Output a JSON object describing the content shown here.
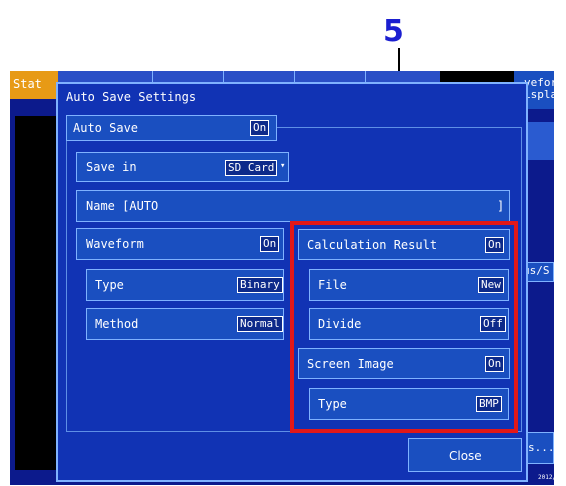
{
  "callout": {
    "number": "5"
  },
  "background": {
    "tab_left": "Stat",
    "right_header": [
      "vefor",
      "isplay"
    ],
    "rate_value": "us/S",
    "bottom_button": "s...",
    "date_fragment": "2012/01"
  },
  "dialog": {
    "title": "Auto Save Settings",
    "auto_save": {
      "label": "Auto Save",
      "value": "On"
    },
    "save_in": {
      "label": "Save in",
      "value": "SD Card"
    },
    "name": {
      "label": "Name [AUTO",
      "end": "]"
    },
    "waveform": {
      "label": "Waveform",
      "value": "On"
    },
    "waveform_type": {
      "label": "Type",
      "value": "Binary"
    },
    "waveform_method": {
      "label": "Method",
      "value": "Normal"
    },
    "calc_result": {
      "label": "Calculation Result",
      "value": "On"
    },
    "calc_file": {
      "label": "File",
      "value": "New"
    },
    "calc_divide": {
      "label": "Divide",
      "value": "Off"
    },
    "screen_image": {
      "label": "Screen Image",
      "value": "On"
    },
    "screen_type": {
      "label": "Type",
      "value": "BMP"
    },
    "close_label": "Close"
  }
}
